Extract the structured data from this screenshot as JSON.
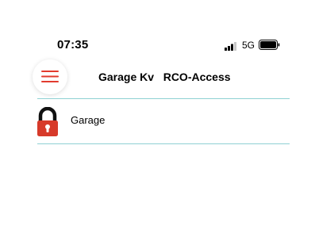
{
  "status_bar": {
    "time": "07:35",
    "network": "5G",
    "signal_icon": "signal-bars-icon",
    "battery_icon": "battery-icon"
  },
  "header": {
    "menu_icon": "hamburger-menu-icon",
    "title": "Garage Kv   RCO-Access",
    "accent_color": "#e23b2e"
  },
  "list": {
    "items": [
      {
        "label": "Garage",
        "icon": "padlock-icon",
        "state": "locked",
        "color": "#d73a2a"
      }
    ],
    "divider_color": "#8fd1d3"
  }
}
